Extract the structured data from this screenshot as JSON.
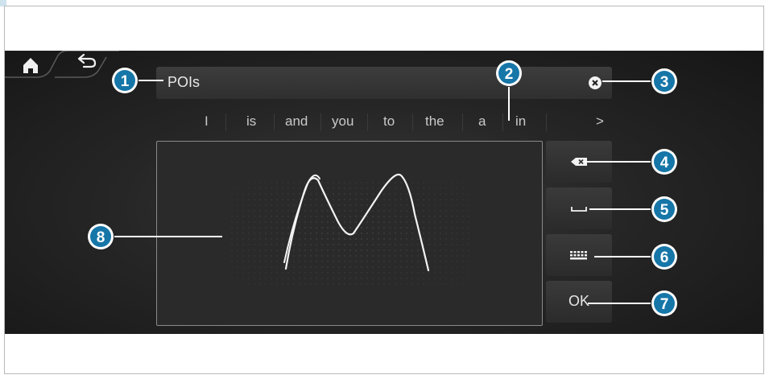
{
  "search": {
    "text": "POIs"
  },
  "suggestions": [
    "I",
    "is",
    "and",
    "you",
    "to",
    "the",
    "a",
    "in"
  ],
  "suggestions_more": ">",
  "buttons": {
    "ok_label": "OK"
  },
  "callouts": [
    "1",
    "2",
    "3",
    "4",
    "5",
    "6",
    "7",
    "8"
  ],
  "colors": {
    "callout_fill": "#1676a8",
    "callout_ring": "#ffffff",
    "screen_bg": "#262626"
  },
  "icons": [
    "home-icon",
    "back-icon",
    "clear-icon",
    "backspace-icon",
    "space-icon",
    "keyboard-icon"
  ]
}
